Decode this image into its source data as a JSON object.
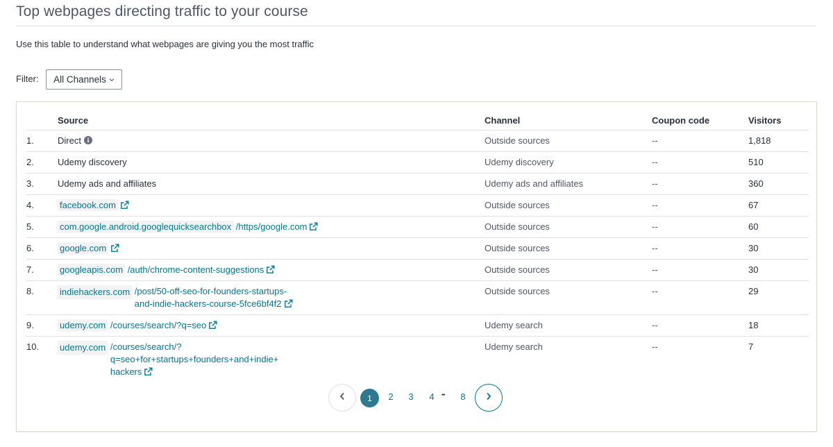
{
  "page": {
    "title": "Top webpages directing traffic to your course",
    "description": "Use this table to understand what webpages are giving you the most traffic"
  },
  "filter": {
    "label": "Filter:",
    "selected": "All Channels"
  },
  "table": {
    "headers": {
      "source": "Source",
      "channel": "Channel",
      "coupon": "Coupon code",
      "visitors": "Visitors"
    },
    "rows": [
      {
        "num": "1.",
        "domain": "Direct",
        "path": "",
        "channel": "Outside sources",
        "coupon": "--",
        "visitors": "1,818"
      },
      {
        "num": "2.",
        "domain": "Udemy discovery",
        "path": "",
        "channel": "Udemy discovery",
        "coupon": "--",
        "visitors": "510"
      },
      {
        "num": "3.",
        "domain": "Udemy ads and affiliates",
        "path": "",
        "channel": "Udemy ads and affiliates",
        "coupon": "--",
        "visitors": "360"
      },
      {
        "num": "4.",
        "domain": "facebook.com",
        "path": "",
        "channel": "Outside sources",
        "coupon": "--",
        "visitors": "67"
      },
      {
        "num": "5.",
        "domain": "com.google.android.googlequicksearchbox",
        "path": "/https/google.com",
        "channel": "Outside sources",
        "coupon": "--",
        "visitors": "60"
      },
      {
        "num": "6.",
        "domain": "google.com",
        "path": "",
        "channel": "Outside sources",
        "coupon": "--",
        "visitors": "30"
      },
      {
        "num": "7.",
        "domain": "googleapis.com",
        "path": "/auth/chrome-content-suggestions",
        "channel": "Outside sources",
        "coupon": "--",
        "visitors": "30"
      },
      {
        "num": "8.",
        "domain": "indiehackers.com",
        "path_line1": "/post/50-off-seo-for-founders-startups-",
        "path_line2": "and-indie-hackers-course-5fce6bf4f2",
        "channel": "Outside sources",
        "coupon": "--",
        "visitors": "29"
      },
      {
        "num": "9.",
        "domain": "udemy.com",
        "path": "/courses/search/?q=seo",
        "channel": "Udemy search",
        "coupon": "--",
        "visitors": "18"
      },
      {
        "num": "10.",
        "domain": "udemy.com",
        "path_line1": "/courses/search/?",
        "path_line2": "q=seo+for+startups+founders+and+indie+",
        "path_line3": "hackers",
        "channel": "Udemy search",
        "coupon": "--",
        "visitors": "7"
      }
    ]
  },
  "pagination": {
    "pages": [
      "1",
      "2",
      "3",
      "4",
      "8"
    ],
    "ellipsis": "•••",
    "current": "1"
  },
  "colors": {
    "accent": "#007791",
    "active_page": "#2d7a8e",
    "text": "#29303b",
    "muted": "#505763",
    "border": "#dedfe0"
  },
  "icons": [
    "external-link-icon",
    "info-icon",
    "chevron-left-icon",
    "chevron-right-icon",
    "chevron-down-icon"
  ]
}
